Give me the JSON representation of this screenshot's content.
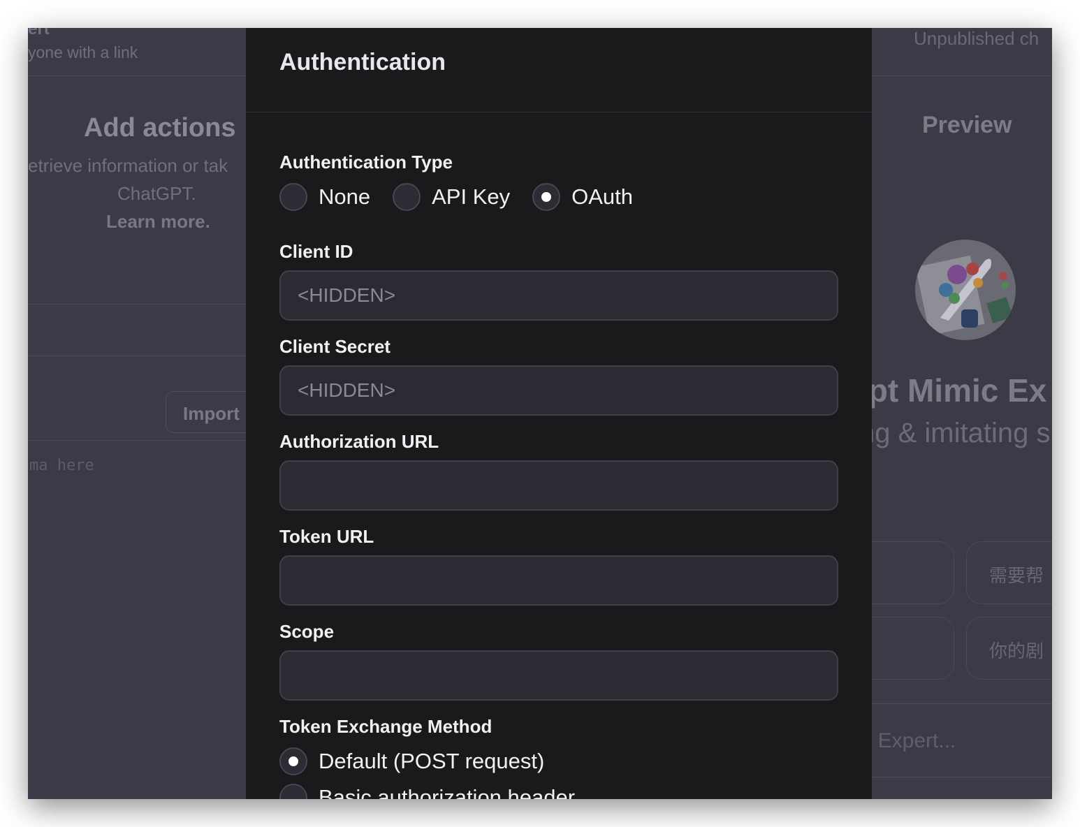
{
  "background": {
    "share": {
      "title_fragment": "ert",
      "setting": "yone with a link"
    },
    "actions": {
      "title": "Add actions",
      "description_line1": "etrieve information or tak",
      "description_line2": "ChatGPT.",
      "learn_more": "Learn more.",
      "import_button": "Import",
      "schema_placeholder": "ma here"
    },
    "status": "Unpublished ch",
    "preview": {
      "title": "Preview",
      "gpt_name": "ipt Mimic Ex",
      "gpt_description": "ng & imitating s",
      "starter_1": "需要帮",
      "starter_2": "你的剧",
      "message_placeholder": ": Expert..."
    }
  },
  "modal": {
    "title": "Authentication",
    "auth_type": {
      "label": "Authentication Type",
      "options": [
        "None",
        "API Key",
        "OAuth"
      ],
      "selected": "OAuth"
    },
    "client_id": {
      "label": "Client ID",
      "placeholder": "<HIDDEN>"
    },
    "client_secret": {
      "label": "Client Secret",
      "placeholder": "<HIDDEN>"
    },
    "authorization_url": {
      "label": "Authorization URL",
      "value": ""
    },
    "token_url": {
      "label": "Token URL",
      "value": ""
    },
    "scope": {
      "label": "Scope",
      "value": ""
    },
    "token_exchange": {
      "label": "Token Exchange Method",
      "options": [
        "Default (POST request)",
        "Basic authorization header"
      ],
      "selected": "Default (POST request)"
    }
  }
}
